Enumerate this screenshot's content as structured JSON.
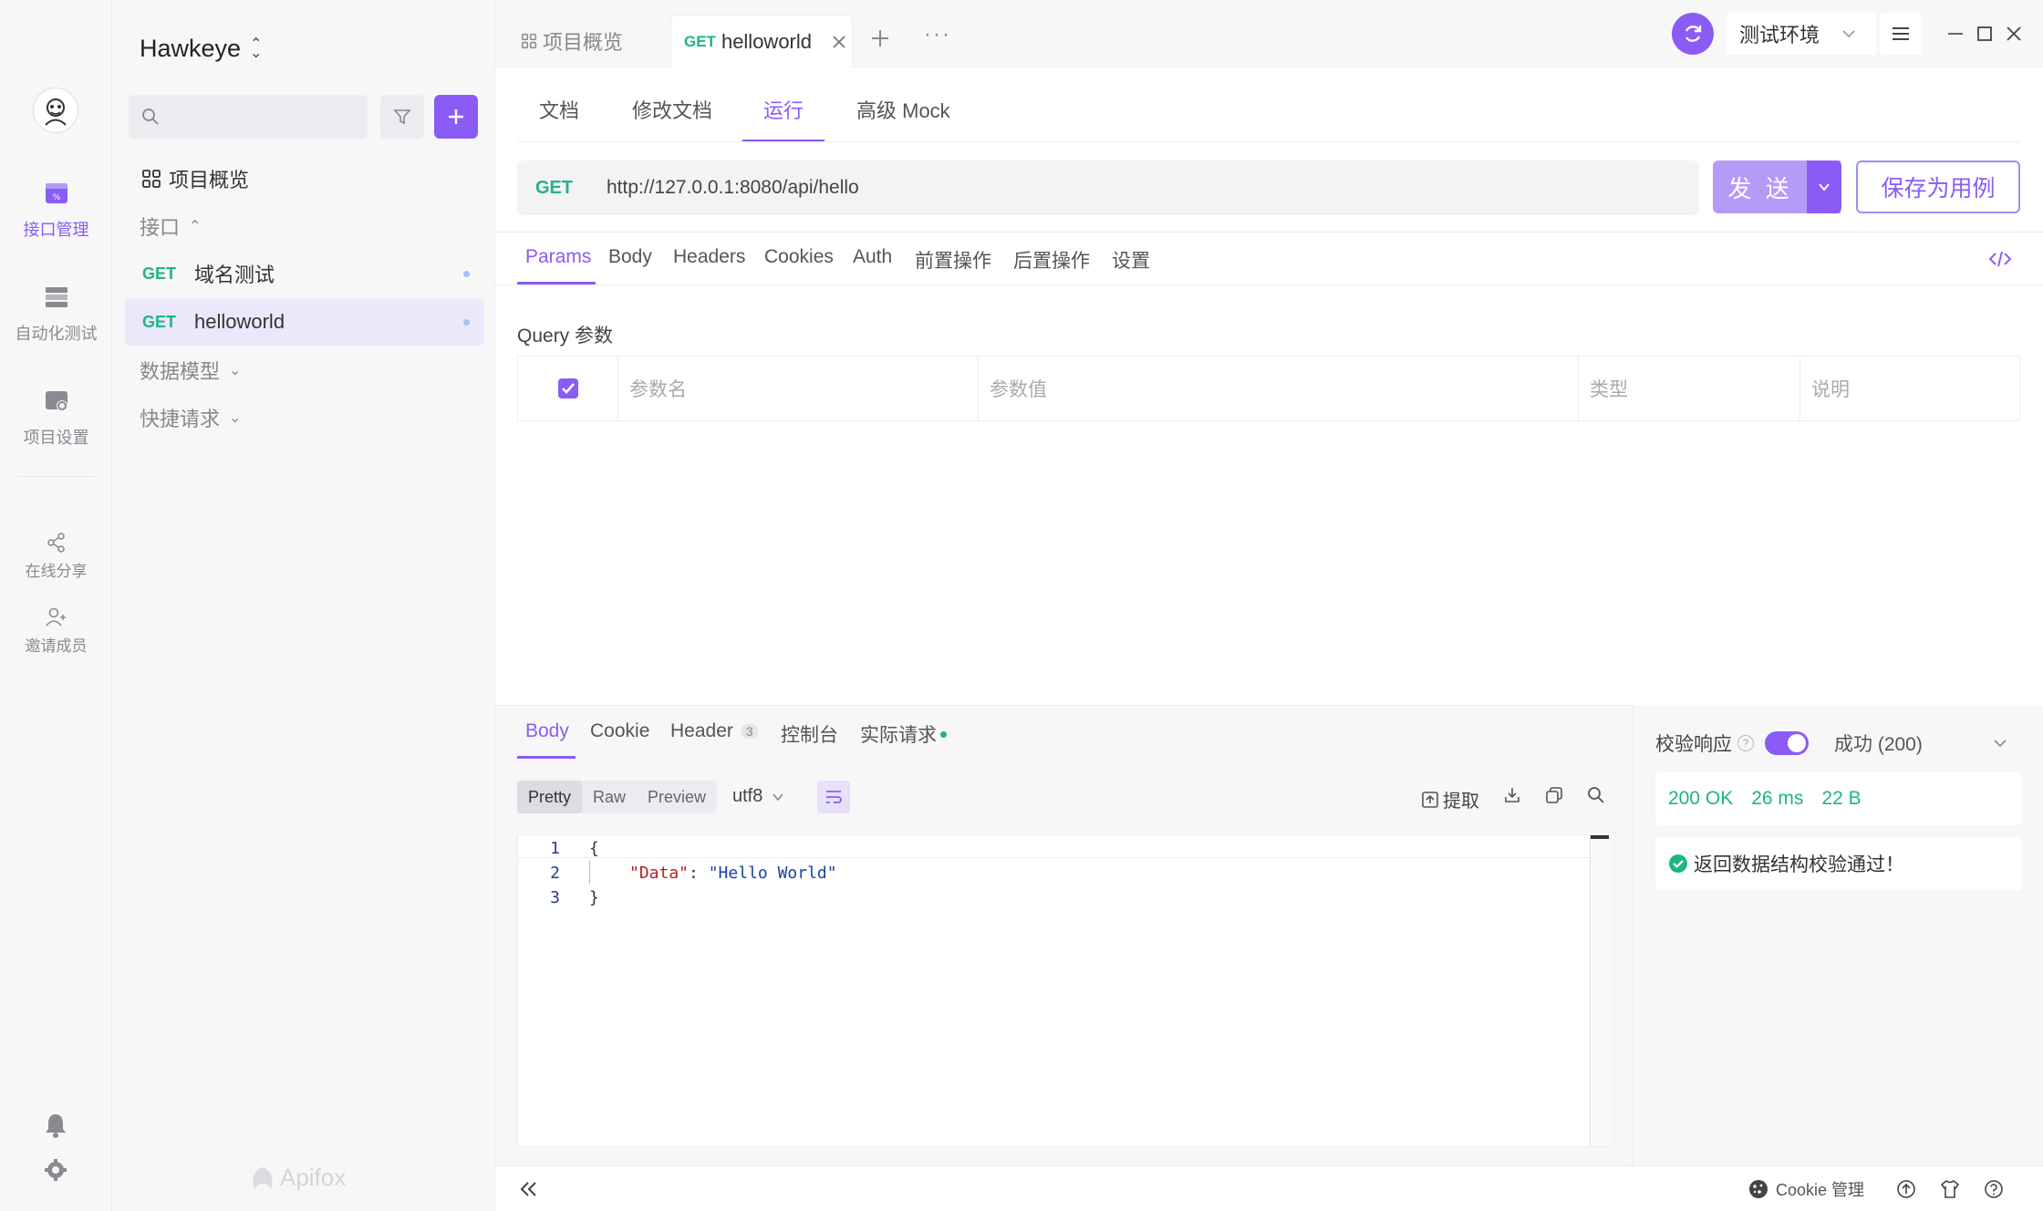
{
  "rail": {
    "items": [
      {
        "label": "接口管理",
        "icon": "api-manage-icon"
      },
      {
        "label": "自动化测试",
        "icon": "automation-icon"
      },
      {
        "label": "项目设置",
        "icon": "project-settings-icon"
      }
    ],
    "share_label": "在线分享",
    "invite_label": "邀请成员"
  },
  "sidebar": {
    "project_name": "Hawkeye",
    "overview_label": "项目概览",
    "interfaces_label": "接口",
    "endpoints": [
      {
        "method": "GET",
        "name": "域名测试"
      },
      {
        "method": "GET",
        "name": "helloworld"
      }
    ],
    "data_model_label": "数据模型",
    "quick_request_label": "快捷请求",
    "watermark": "Apifox"
  },
  "topbar": {
    "tab_overview": "项目概览",
    "tab_active_method": "GET",
    "tab_active_name": "helloworld",
    "env_label": "测试环境"
  },
  "subtabs": [
    "文档",
    "修改文档",
    "运行",
    "高级 Mock"
  ],
  "request": {
    "method": "GET",
    "url": "http://127.0.0.1:8080/api/hello",
    "send_label": "发 送",
    "save_label": "保存为用例"
  },
  "param_tabs": [
    "Params",
    "Body",
    "Headers",
    "Cookies",
    "Auth",
    "前置操作",
    "后置操作",
    "设置"
  ],
  "query": {
    "title": "Query 参数",
    "columns": [
      "参数名",
      "参数值",
      "类型",
      "说明"
    ]
  },
  "response": {
    "tabs": [
      "Body",
      "Cookie",
      "Header",
      "控制台",
      "实际请求"
    ],
    "header_count": "3",
    "formats": [
      "Pretty",
      "Raw",
      "Preview"
    ],
    "encoding": "utf8",
    "extract_label": "提取",
    "code_lines": [
      "1",
      "2",
      "3"
    ],
    "code": {
      "open": "{",
      "key": "\"Data\"",
      "value": "\"Hello World\"",
      "close": "}"
    },
    "validate_label": "校验响应",
    "validate_result": "成功 (200)",
    "status": "200 OK",
    "time": "26 ms",
    "size": "22 B",
    "validate_message": "返回数据结构校验通过！"
  },
  "footer": {
    "cookie_manage": "Cookie 管理"
  },
  "colors": {
    "accent": "#8a5cf5",
    "get": "#1fb486",
    "success": "#1fb486"
  }
}
